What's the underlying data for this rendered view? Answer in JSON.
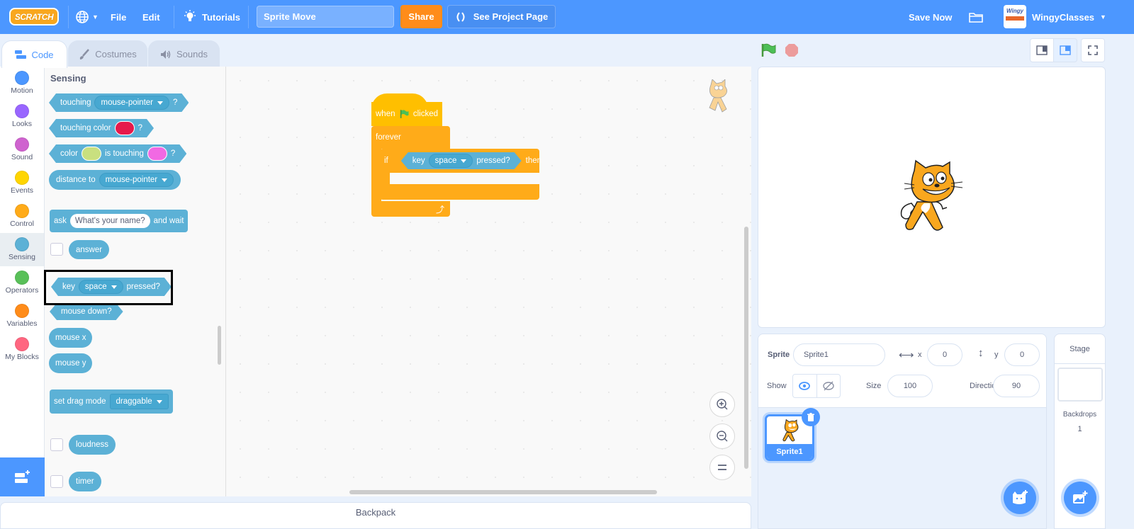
{
  "menubar": {
    "logo": "SCRATCH",
    "file": "File",
    "edit": "Edit",
    "tutorials": "Tutorials",
    "project_title": "Sprite Move",
    "share": "Share",
    "see_project_page": "See Project Page",
    "save_now": "Save Now",
    "avatar_text": "Wingy",
    "username": "WingyClasses"
  },
  "tabs": [
    {
      "label": "Code",
      "active": true
    },
    {
      "label": "Costumes"
    },
    {
      "label": "Sounds"
    }
  ],
  "categories": [
    {
      "label": "Motion",
      "color": "#4c97ff"
    },
    {
      "label": "Looks",
      "color": "#9966ff"
    },
    {
      "label": "Sound",
      "color": "#cf63cf"
    },
    {
      "label": "Events",
      "color": "#ffd500"
    },
    {
      "label": "Control",
      "color": "#ffab19"
    },
    {
      "label": "Sensing",
      "color": "#5cb1d6",
      "selected": true
    },
    {
      "label": "Operators",
      "color": "#59c059"
    },
    {
      "label": "Variables",
      "color": "#ff8c1a"
    },
    {
      "label": "My Blocks",
      "color": "#ff6680"
    }
  ],
  "palette": {
    "title": "Sensing",
    "touching": {
      "label": "touching",
      "menu": "mouse-pointer",
      "q": "?"
    },
    "touching_color": {
      "label": "touching color",
      "swatch": "#e6194b",
      "q": "?"
    },
    "color_touching": {
      "label1": "color",
      "swatch1": "#c9e07f",
      "label2": "is touching",
      "swatch2": "#f169e3",
      "q": "?"
    },
    "distance_to": {
      "label": "distance to",
      "menu": "mouse-pointer"
    },
    "ask": {
      "label1": "ask",
      "input": "What's your name?",
      "label2": "and wait"
    },
    "answer": "answer",
    "key_pressed": {
      "label1": "key",
      "menu": "space",
      "label2": "pressed?"
    },
    "mouse_down": "mouse down?",
    "mouse_x": "mouse x",
    "mouse_y": "mouse y",
    "drag_mode": {
      "label": "set drag mode",
      "menu": "draggable"
    },
    "loudness": "loudness",
    "timer": "timer"
  },
  "script": {
    "hat": {
      "label1": "when",
      "label2": "clicked"
    },
    "forever": "forever",
    "if": {
      "label": "if",
      "then": "then",
      "condition": {
        "label1": "key",
        "menu": "space",
        "label2": "pressed?"
      }
    }
  },
  "backpack": "Backpack",
  "sprite_info": {
    "sprite_label": "Sprite",
    "sprite_name": "Sprite1",
    "x_label": "x",
    "x": "0",
    "y_label": "y",
    "y": "0",
    "show_label": "Show",
    "size_label": "Size",
    "size": "100",
    "direction_label": "Direction",
    "direction": "90"
  },
  "sprites": [
    {
      "name": "Sprite1",
      "selected": true
    }
  ],
  "stage_pane": {
    "title": "Stage",
    "backdrops_label": "Backdrops",
    "backdrops_count": "1"
  }
}
